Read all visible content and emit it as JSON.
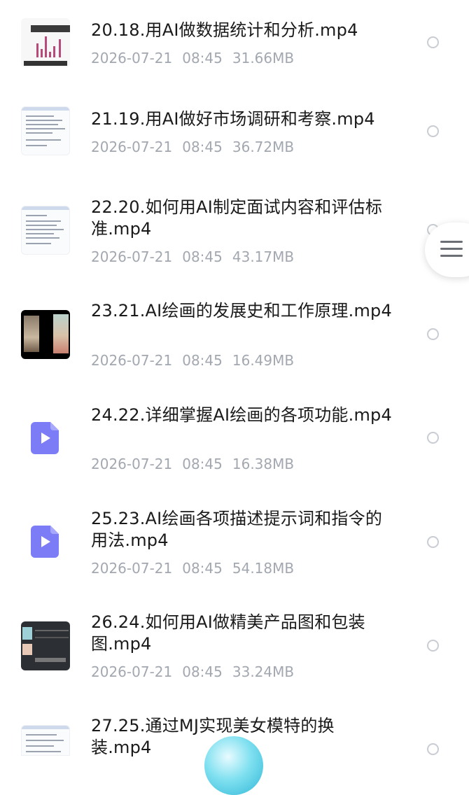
{
  "files": [
    {
      "name": "20.18.用AI做数据统计和分析.mp4",
      "date": "2026-07-21",
      "time": "08:45",
      "size": "31.66MB",
      "thumb": "chart"
    },
    {
      "name": "21.19.用AI做好市场调研和考察.mp4",
      "date": "2026-07-21",
      "time": "08:45",
      "size": "36.72MB",
      "thumb": "doc"
    },
    {
      "name": "22.20.如何用AI制定面试内容和评估标准.mp4",
      "date": "2026-07-21",
      "time": "08:45",
      "size": "43.17MB",
      "thumb": "doc"
    },
    {
      "name": "23.21.AI绘画的发展史和工作原理.mp4",
      "date": "2026-07-21",
      "time": "08:45",
      "size": "16.49MB",
      "thumb": "dark"
    },
    {
      "name": "24.22.详细掌握AI绘画的各项功能.mp4",
      "date": "2026-07-21",
      "time": "08:45",
      "size": "16.38MB",
      "thumb": "video-file-icon"
    },
    {
      "name": "25.23.AI绘画各项描述提示词和指令的用法.mp4",
      "date": "2026-07-21",
      "time": "08:45",
      "size": "54.18MB",
      "thumb": "video-file-icon"
    },
    {
      "name": "26.24.如何用AI做精美产品图和包装图.mp4",
      "date": "2026-07-21",
      "time": "08:45",
      "size": "33.24MB",
      "thumb": "screen"
    },
    {
      "name": "27.25.通过MJ实现美女模特的换装.mp4",
      "date": "",
      "time": "",
      "size": "",
      "thumb": "doc"
    }
  ],
  "icons": {
    "menu": "hamburger-menu-icon",
    "file": "video-file-icon",
    "radio": "radio-unchecked-icon"
  },
  "colors": {
    "accent": "#7b7cf6",
    "meta": "#a3a8b0",
    "text": "#1a1a1a",
    "radio": "#c9cdd3"
  }
}
